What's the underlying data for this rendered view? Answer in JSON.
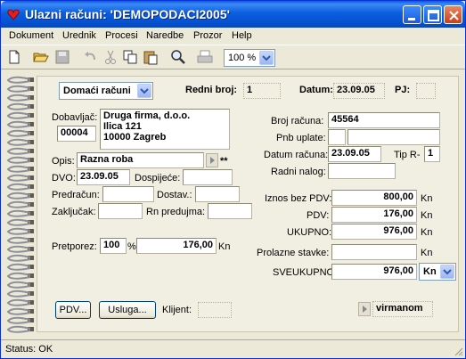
{
  "window": {
    "title": "Ulazni računi: 'DEMOPODACI2005'"
  },
  "menu": [
    "Dokument",
    "Urednik",
    "Procesi",
    "Naredbe",
    "Prozor",
    "Help"
  ],
  "toolbar": {
    "zoom": "100 %"
  },
  "form": {
    "doc_type": "Domaći računi",
    "redni_broj_label": "Redni broj:",
    "redni_broj": "1",
    "datum_label": "Datum:",
    "datum": "23.09.05",
    "pj_label": "PJ:",
    "pj": "",
    "dobavljac_label": "Dobavljač:",
    "dobavljac_code": "00004",
    "dobavljac_name": "Druga firma, d.o.o.",
    "dobavljac_address": "Ilica 121",
    "dobavljac_city": "10000 Zagreb",
    "opis_label": "Opis:",
    "opis": "Razna roba",
    "opis_suffix": "**",
    "dvo_label": "DVO:",
    "dvo": "23.09.05",
    "dospijece_label": "Dospijeće:",
    "dospijece": "",
    "predracun_label": "Predračun:",
    "predracun": "",
    "dostav_label": "Dostav.:",
    "dostav": "",
    "zakljucak_label": "Zaključak:",
    "zakljucak": "",
    "rn_predujma_label": "Rn predujma:",
    "rn_predujma": "",
    "pretporez_label": "Pretporez:",
    "pretporez_pct": "100",
    "pct_sign": "%",
    "pretporez_amount": "176,00",
    "kn": "Kn",
    "broj_racuna_label": "Broj računa:",
    "broj_racuna": "45564",
    "pnb_label": "Pnb uplate:",
    "pnb_1": "",
    "pnb_2": "",
    "datum_racuna_label": "Datum računa:",
    "datum_racuna": "23.09.05",
    "tip_label": "Tip R-",
    "tip": "1",
    "radni_nalog_label": "Radni nalog:",
    "radni_nalog": "",
    "iznos_bez_pdv_label": "Iznos bez PDV:",
    "iznos_bez_pdv": "800,00",
    "pdv_label": "PDV:",
    "pdv": "176,00",
    "ukupno_label": "UKUPNO:",
    "ukupno": "976,00",
    "prolazne_label": "Prolazne stavke:",
    "prolazne": "",
    "sveukupno_label": "SVEUKUPNO:",
    "sveukupno": "976,00",
    "currency": "Kn",
    "pdv_button": "PDV...",
    "usluga_button": "Usluga...",
    "klijent_label": "Klijent:",
    "klijent": "",
    "payment": "virmanom"
  },
  "status": {
    "text": "Status: OK"
  }
}
